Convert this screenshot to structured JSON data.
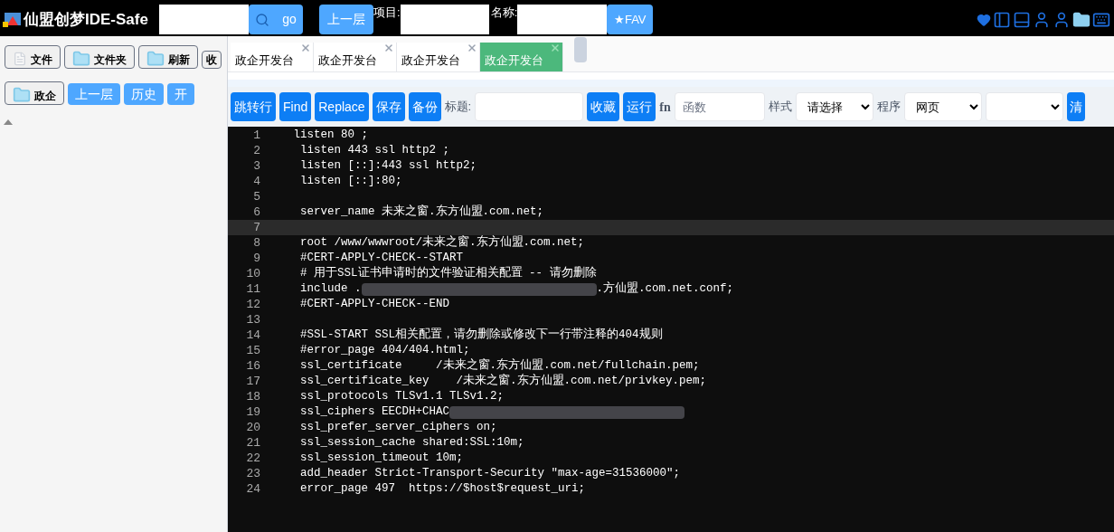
{
  "header": {
    "title": "仙盟创梦IDE-Safe",
    "go_button": "go",
    "up_button": "上一层",
    "project_label": "项目:",
    "name_label": "名称:",
    "fav_button": "★FAV"
  },
  "sidebar": {
    "toolbar": [
      {
        "label": "文件",
        "kind": "file"
      },
      {
        "label": "文件夹",
        "kind": "folder"
      },
      {
        "label": "刷新",
        "kind": "folder"
      },
      {
        "label": "收",
        "kind": "plain"
      }
    ],
    "nav": [
      {
        "label": "政企",
        "kind": "folder"
      },
      {
        "label": "上一层",
        "kind": "blue"
      },
      {
        "label": "历史",
        "kind": "blue"
      },
      {
        "label": "开",
        "kind": "blue"
      }
    ]
  },
  "tabs": [
    {
      "label": "政企开发台",
      "selected": false
    },
    {
      "label": "政企开发台",
      "selected": false
    },
    {
      "label": "政企开发台",
      "selected": false
    },
    {
      "label": "政企开发台",
      "selected": true
    }
  ],
  "toolbar": {
    "buttons_left": [
      "跳转行",
      "Find",
      "Replace",
      "保存",
      "备份"
    ],
    "title_label": "标题:",
    "buttons_mid": [
      "收藏",
      "运行"
    ],
    "fn_label": "fn",
    "fn_placeholder": "函数",
    "style_label": "样式",
    "style_value": "请选择",
    "program_label": "程序",
    "program_value": "网页",
    "clear_button": "清"
  },
  "editor": {
    "lines": [
      {
        "num": "1",
        "text": "   listen 80 ;",
        "active": false
      },
      {
        "num": "2",
        "text": "    listen 443 ssl http2 ;",
        "active": false
      },
      {
        "num": "3",
        "text": "    listen [::]:443 ssl http2;",
        "active": false
      },
      {
        "num": "4",
        "text": "    listen [::]:80;",
        "active": false
      },
      {
        "num": "5",
        "active": false
      },
      {
        "num": "6",
        "text": "    server_name 未来之窗.东方仙盟.com.net;",
        "active": false
      },
      {
        "num": "7",
        "active": true
      },
      {
        "num": "8",
        "text": "    root /www/wwwroot/未来之窗.东方仙盟.com.net;",
        "active": false
      },
      {
        "num": "9",
        "text": "    #CERT-APPLY-CHECK--START",
        "active": false
      },
      {
        "num": "10",
        "text": "    # 用于SSL证书申请时的文件验证相关配置 -- 请勿删除",
        "active": false
      },
      {
        "num": "11",
        "text": "    include .",
        "redacted": true,
        "after": ".方仙盟.com.net.conf;",
        "active": false
      },
      {
        "num": "12",
        "text": "    #CERT-APPLY-CHECK--END",
        "active": false
      },
      {
        "num": "13",
        "active": false
      },
      {
        "num": "14",
        "text": "    #SSL-START SSL相关配置，请勿删除或修改下一行带注释的404规则",
        "active": false
      },
      {
        "num": "15",
        "text": "    #error_page 404/404.html;",
        "active": false
      },
      {
        "num": "16",
        "text": "    ssl_certificate     /未来之窗.东方仙盟.com.net/fullchain.pem;",
        "active": false
      },
      {
        "num": "17",
        "text": "    ssl_certificate_key    /未来之窗.东方仙盟.com.net/privkey.pem;",
        "active": false
      },
      {
        "num": "18",
        "text": "    ssl_protocols TLSv1.1 TLSv1.2;",
        "active": false
      },
      {
        "num": "19",
        "text": "    ssl_ciphers EECDH+CHAC",
        "redacted": true,
        "active": false
      },
      {
        "num": "20",
        "text": "    ssl_prefer_server_ciphers on;",
        "active": false
      },
      {
        "num": "21",
        "text": "    ssl_session_cache shared:SSL:10m;",
        "active": false
      },
      {
        "num": "22",
        "text": "    ssl_session_timeout 10m;",
        "active": false
      },
      {
        "num": "23",
        "text": "    add_header Strict-Transport-Security \"max-age=31536000\";",
        "active": false
      },
      {
        "num": "24",
        "text": "    error_page 497  https://$host$request_uri;",
        "active": false
      }
    ]
  }
}
